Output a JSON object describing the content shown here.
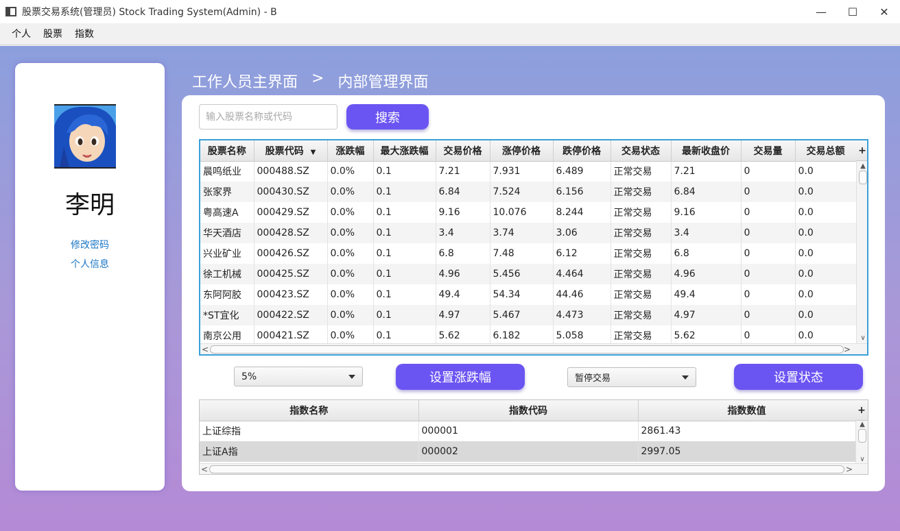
{
  "window": {
    "title": "股票交易系统(管理员) Stock Trading System(Admin) - B",
    "controls": {
      "minimize": "—",
      "maximize": "☐",
      "close": "✕"
    }
  },
  "menu": [
    "个人",
    "股票",
    "指数"
  ],
  "profile": {
    "name": "李明",
    "links": {
      "change_password": "修改密码",
      "personal_info": "个人信息"
    }
  },
  "breadcrumb": {
    "home": "工作人员主界面",
    "separator": ">",
    "current": "内部管理界面"
  },
  "search": {
    "placeholder": "输入股票名称或代码",
    "button": "搜索"
  },
  "stock_table": {
    "columns": [
      "股票名称",
      "股票代码",
      "涨跌幅",
      "最大涨跌幅",
      "交易价格",
      "涨停价格",
      "跌停价格",
      "交易状态",
      "最新收盘价",
      "交易量",
      "交易总额"
    ],
    "sort_icon": "▼",
    "rows": [
      [
        "晨鸣纸业",
        "000488.SZ",
        "0.0%",
        "0.1",
        "7.21",
        "7.931",
        "6.489",
        "正常交易",
        "7.21",
        "0",
        "0.0"
      ],
      [
        "张家界",
        "000430.SZ",
        "0.0%",
        "0.1",
        "6.84",
        "7.524",
        "6.156",
        "正常交易",
        "6.84",
        "0",
        "0.0"
      ],
      [
        "粤高速A",
        "000429.SZ",
        "0.0%",
        "0.1",
        "9.16",
        "10.076",
        "8.244",
        "正常交易",
        "9.16",
        "0",
        "0.0"
      ],
      [
        "华天酒店",
        "000428.SZ",
        "0.0%",
        "0.1",
        "3.4",
        "3.74",
        "3.06",
        "正常交易",
        "3.4",
        "0",
        "0.0"
      ],
      [
        "兴业矿业",
        "000426.SZ",
        "0.0%",
        "0.1",
        "6.8",
        "7.48",
        "6.12",
        "正常交易",
        "6.8",
        "0",
        "0.0"
      ],
      [
        "徐工机械",
        "000425.SZ",
        "0.0%",
        "0.1",
        "4.96",
        "5.456",
        "4.464",
        "正常交易",
        "4.96",
        "0",
        "0.0"
      ],
      [
        "东阿阿胶",
        "000423.SZ",
        "0.0%",
        "0.1",
        "49.4",
        "54.34",
        "44.46",
        "正常交易",
        "49.4",
        "0",
        "0.0"
      ],
      [
        "*ST宜化",
        "000422.SZ",
        "0.0%",
        "0.1",
        "4.97",
        "5.467",
        "4.473",
        "正常交易",
        "4.97",
        "0",
        "0.0"
      ],
      [
        "南京公用",
        "000421.SZ",
        "0.0%",
        "0.1",
        "5.62",
        "6.182",
        "5.058",
        "正常交易",
        "5.62",
        "0",
        "0.0"
      ]
    ]
  },
  "controls": {
    "range_value": "5%",
    "set_range_button": "设置涨跌幅",
    "status_value": "暂停交易",
    "set_status_button": "设置状态"
  },
  "index_table": {
    "columns": [
      "指数名称",
      "指数代码",
      "指数数值"
    ],
    "rows": [
      [
        "上证综指",
        "000001",
        "2861.43"
      ],
      [
        "上证A指",
        "000002",
        "2997.05"
      ]
    ]
  },
  "colors": {
    "accent": "#6a55f2",
    "link": "#1976c5",
    "table_focus": "#3aa0d8"
  },
  "icons": {
    "plus": "+",
    "sort_desc": "▼",
    "scroll_up": "▲",
    "scroll_down": "∨",
    "scroll_left": "<",
    "scroll_right": ">"
  }
}
